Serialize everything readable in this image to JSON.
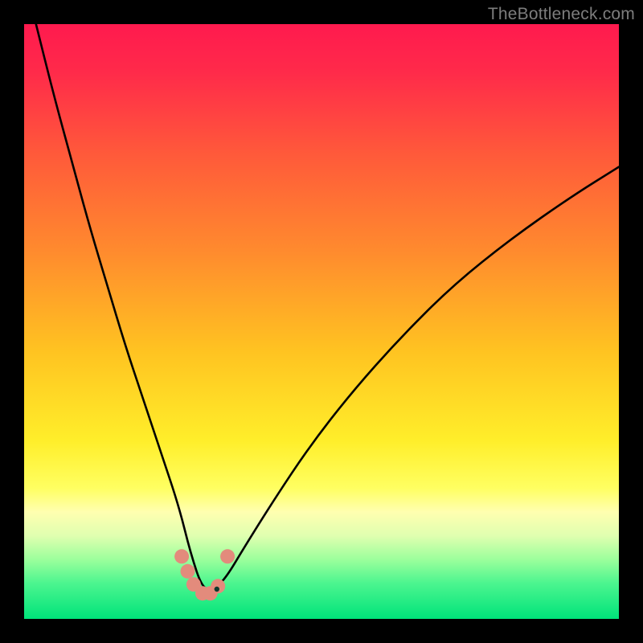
{
  "watermark": "TheBottleneck.com",
  "chart_data": {
    "type": "line",
    "title": "",
    "xlabel": "",
    "ylabel": "",
    "xlim": [
      0,
      100
    ],
    "ylim": [
      0,
      100
    ],
    "grid": false,
    "curve_min_x": 30,
    "curve_min_y": 4,
    "series": [
      {
        "name": "bottleneck-curve",
        "x": [
          2,
          5,
          8,
          11,
          14,
          17,
          20,
          23,
          26,
          28,
          30,
          32,
          34,
          37,
          42,
          48,
          55,
          63,
          72,
          82,
          92,
          100
        ],
        "y": [
          100,
          88,
          77,
          66,
          56,
          46,
          37,
          28,
          19,
          11,
          5,
          5,
          7,
          12,
          20,
          29,
          38,
          47,
          56,
          64,
          71,
          76
        ]
      }
    ],
    "gradient_stops": [
      {
        "pos": 0.0,
        "color": "#ff1a4e"
      },
      {
        "pos": 0.08,
        "color": "#ff2a4a"
      },
      {
        "pos": 0.22,
        "color": "#ff5a3a"
      },
      {
        "pos": 0.38,
        "color": "#ff8a2e"
      },
      {
        "pos": 0.55,
        "color": "#ffc321"
      },
      {
        "pos": 0.7,
        "color": "#ffee2a"
      },
      {
        "pos": 0.78,
        "color": "#ffff61"
      },
      {
        "pos": 0.82,
        "color": "#ffffb0"
      },
      {
        "pos": 0.86,
        "color": "#e0ffb0"
      },
      {
        "pos": 0.9,
        "color": "#9cff9c"
      },
      {
        "pos": 0.94,
        "color": "#4cf58f"
      },
      {
        "pos": 1.0,
        "color": "#00e37a"
      }
    ],
    "pink_dots": [
      {
        "x": 26.5,
        "y": 10.5
      },
      {
        "x": 27.5,
        "y": 8.0
      },
      {
        "x": 28.5,
        "y": 5.8
      },
      {
        "x": 30.0,
        "y": 4.3
      },
      {
        "x": 31.3,
        "y": 4.3
      },
      {
        "x": 32.6,
        "y": 5.5
      },
      {
        "x": 34.2,
        "y": 10.5
      }
    ],
    "tiny_dot": {
      "x": 32.4,
      "y": 5.0
    }
  }
}
